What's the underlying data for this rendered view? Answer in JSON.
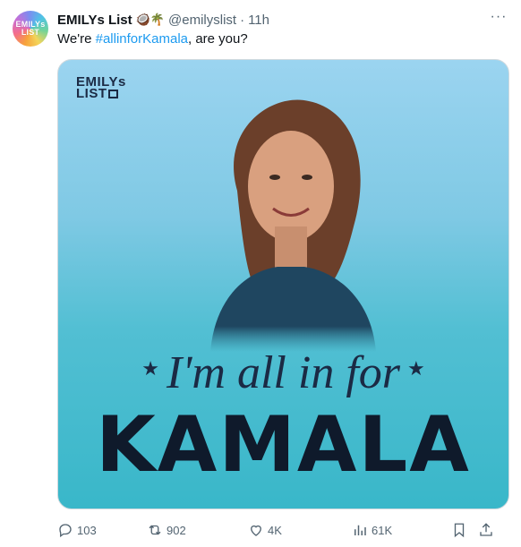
{
  "tweet": {
    "avatar_text_1": "EMILYs",
    "avatar_text_2": "LIST",
    "author_name": "EMILYs List",
    "author_emojis": "🥥🌴",
    "handle": "@emilyslist",
    "separator": "·",
    "time": "11h",
    "text_before": "We're ",
    "hashtag": "#allinforKamala",
    "text_after": ", are you?",
    "more_label": "···"
  },
  "media": {
    "logo_line1": "EMILYs",
    "logo_line2": "LIST",
    "slogan_text": "I'm all in for",
    "name_text": "KAMALA",
    "star": "★",
    "colors": {
      "top": "#9bd4f0",
      "bottom": "#39b7c9",
      "text": "#1b2a44"
    }
  },
  "actions": {
    "replies": "103",
    "reposts": "902",
    "likes": "4K",
    "views": "61K"
  },
  "icons": [
    "reply-icon",
    "repost-icon",
    "like-icon",
    "views-icon",
    "bookmark-icon",
    "share-icon",
    "more-icon"
  ]
}
